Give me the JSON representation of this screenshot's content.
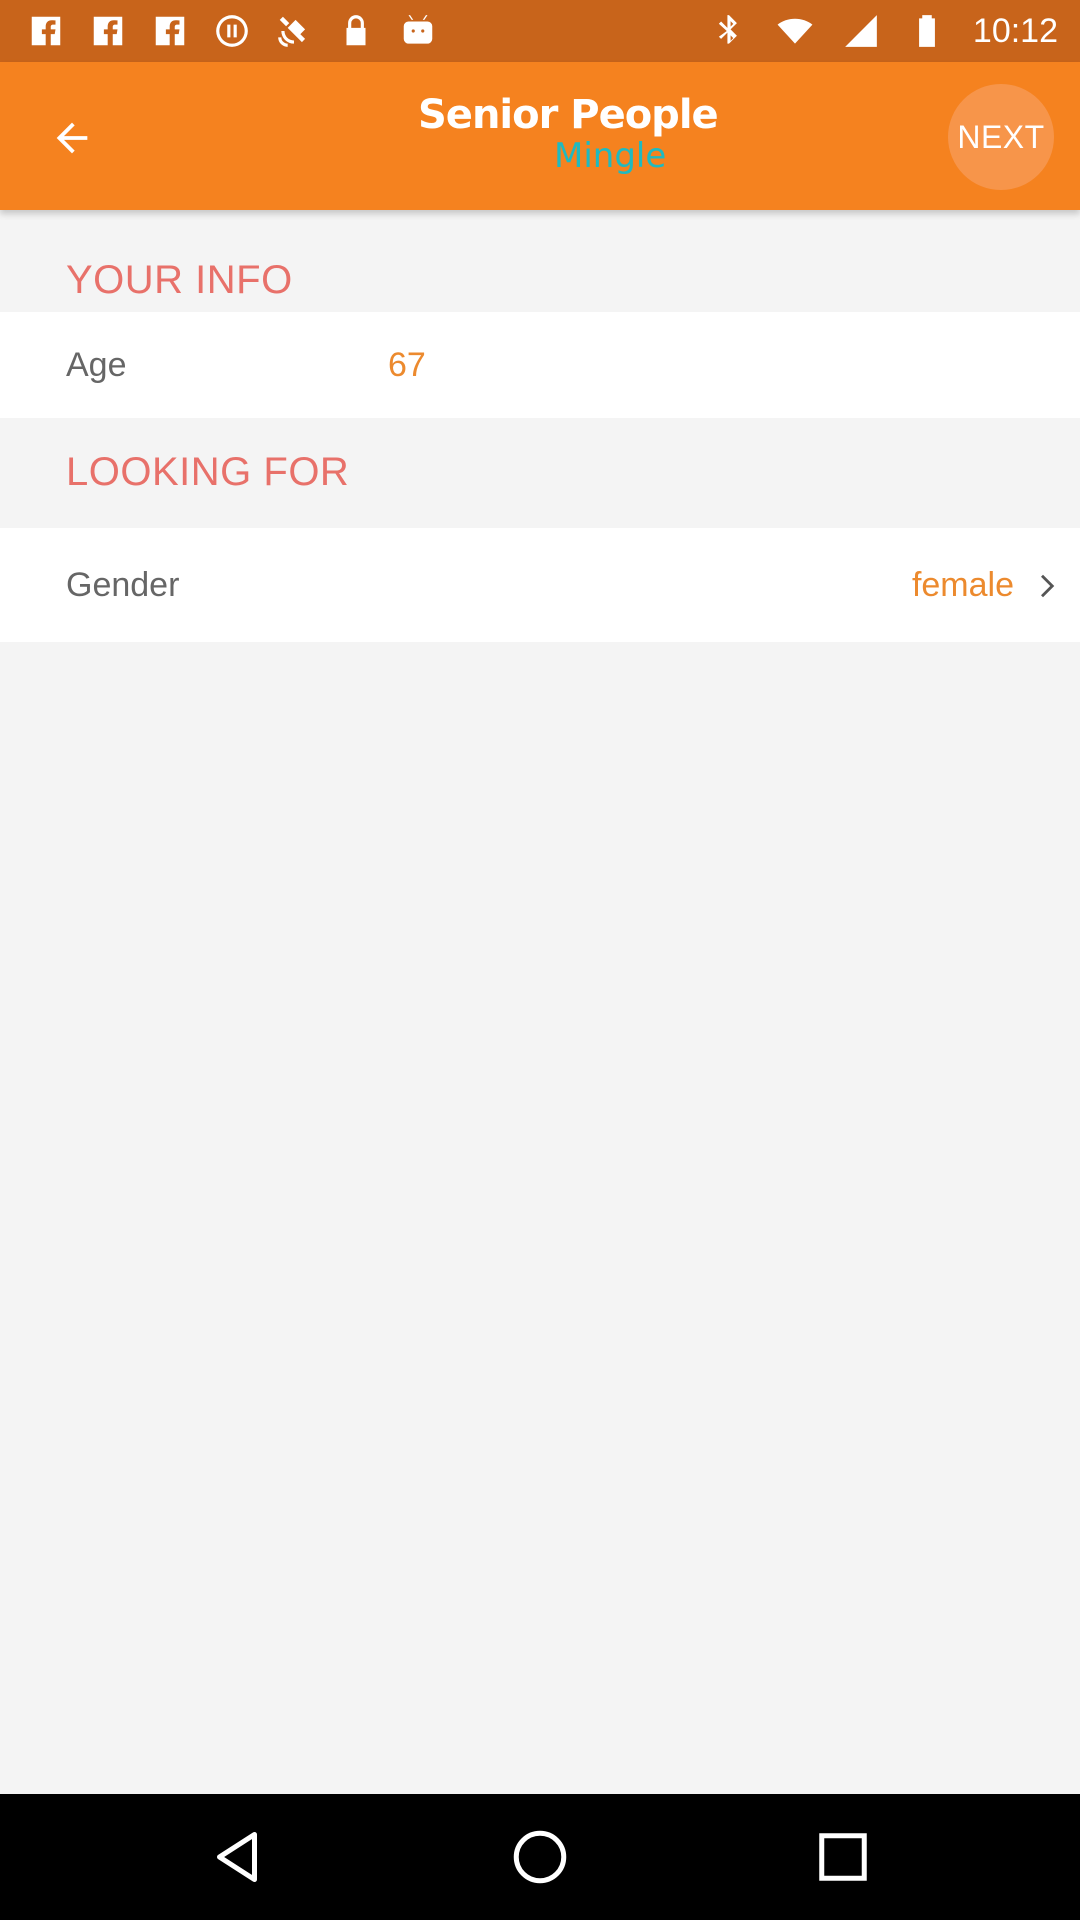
{
  "status_bar": {
    "time": "10:12",
    "icons": [
      "facebook-icon",
      "facebook-icon",
      "facebook-icon",
      "pause-icon",
      "satellite-icon",
      "lock-icon",
      "android-icon",
      "bluetooth-icon",
      "wifi-icon",
      "signal-icon",
      "battery-icon"
    ]
  },
  "app_bar": {
    "logo_line1": "Senior People",
    "logo_line2": "Mingle",
    "next_label": "NEXT",
    "colors": {
      "bar": "#f5821f",
      "logo_accent": "#1fbac0"
    }
  },
  "your_info": {
    "header": "YOUR INFO",
    "age_label": "Age",
    "age_value": "67"
  },
  "looking_for": {
    "header": "LOOKING FOR",
    "gender_label": "Gender",
    "gender_value": "female"
  },
  "nav_bar": {
    "icons": [
      "back-triangle-icon",
      "home-circle-icon",
      "recents-square-icon"
    ]
  }
}
